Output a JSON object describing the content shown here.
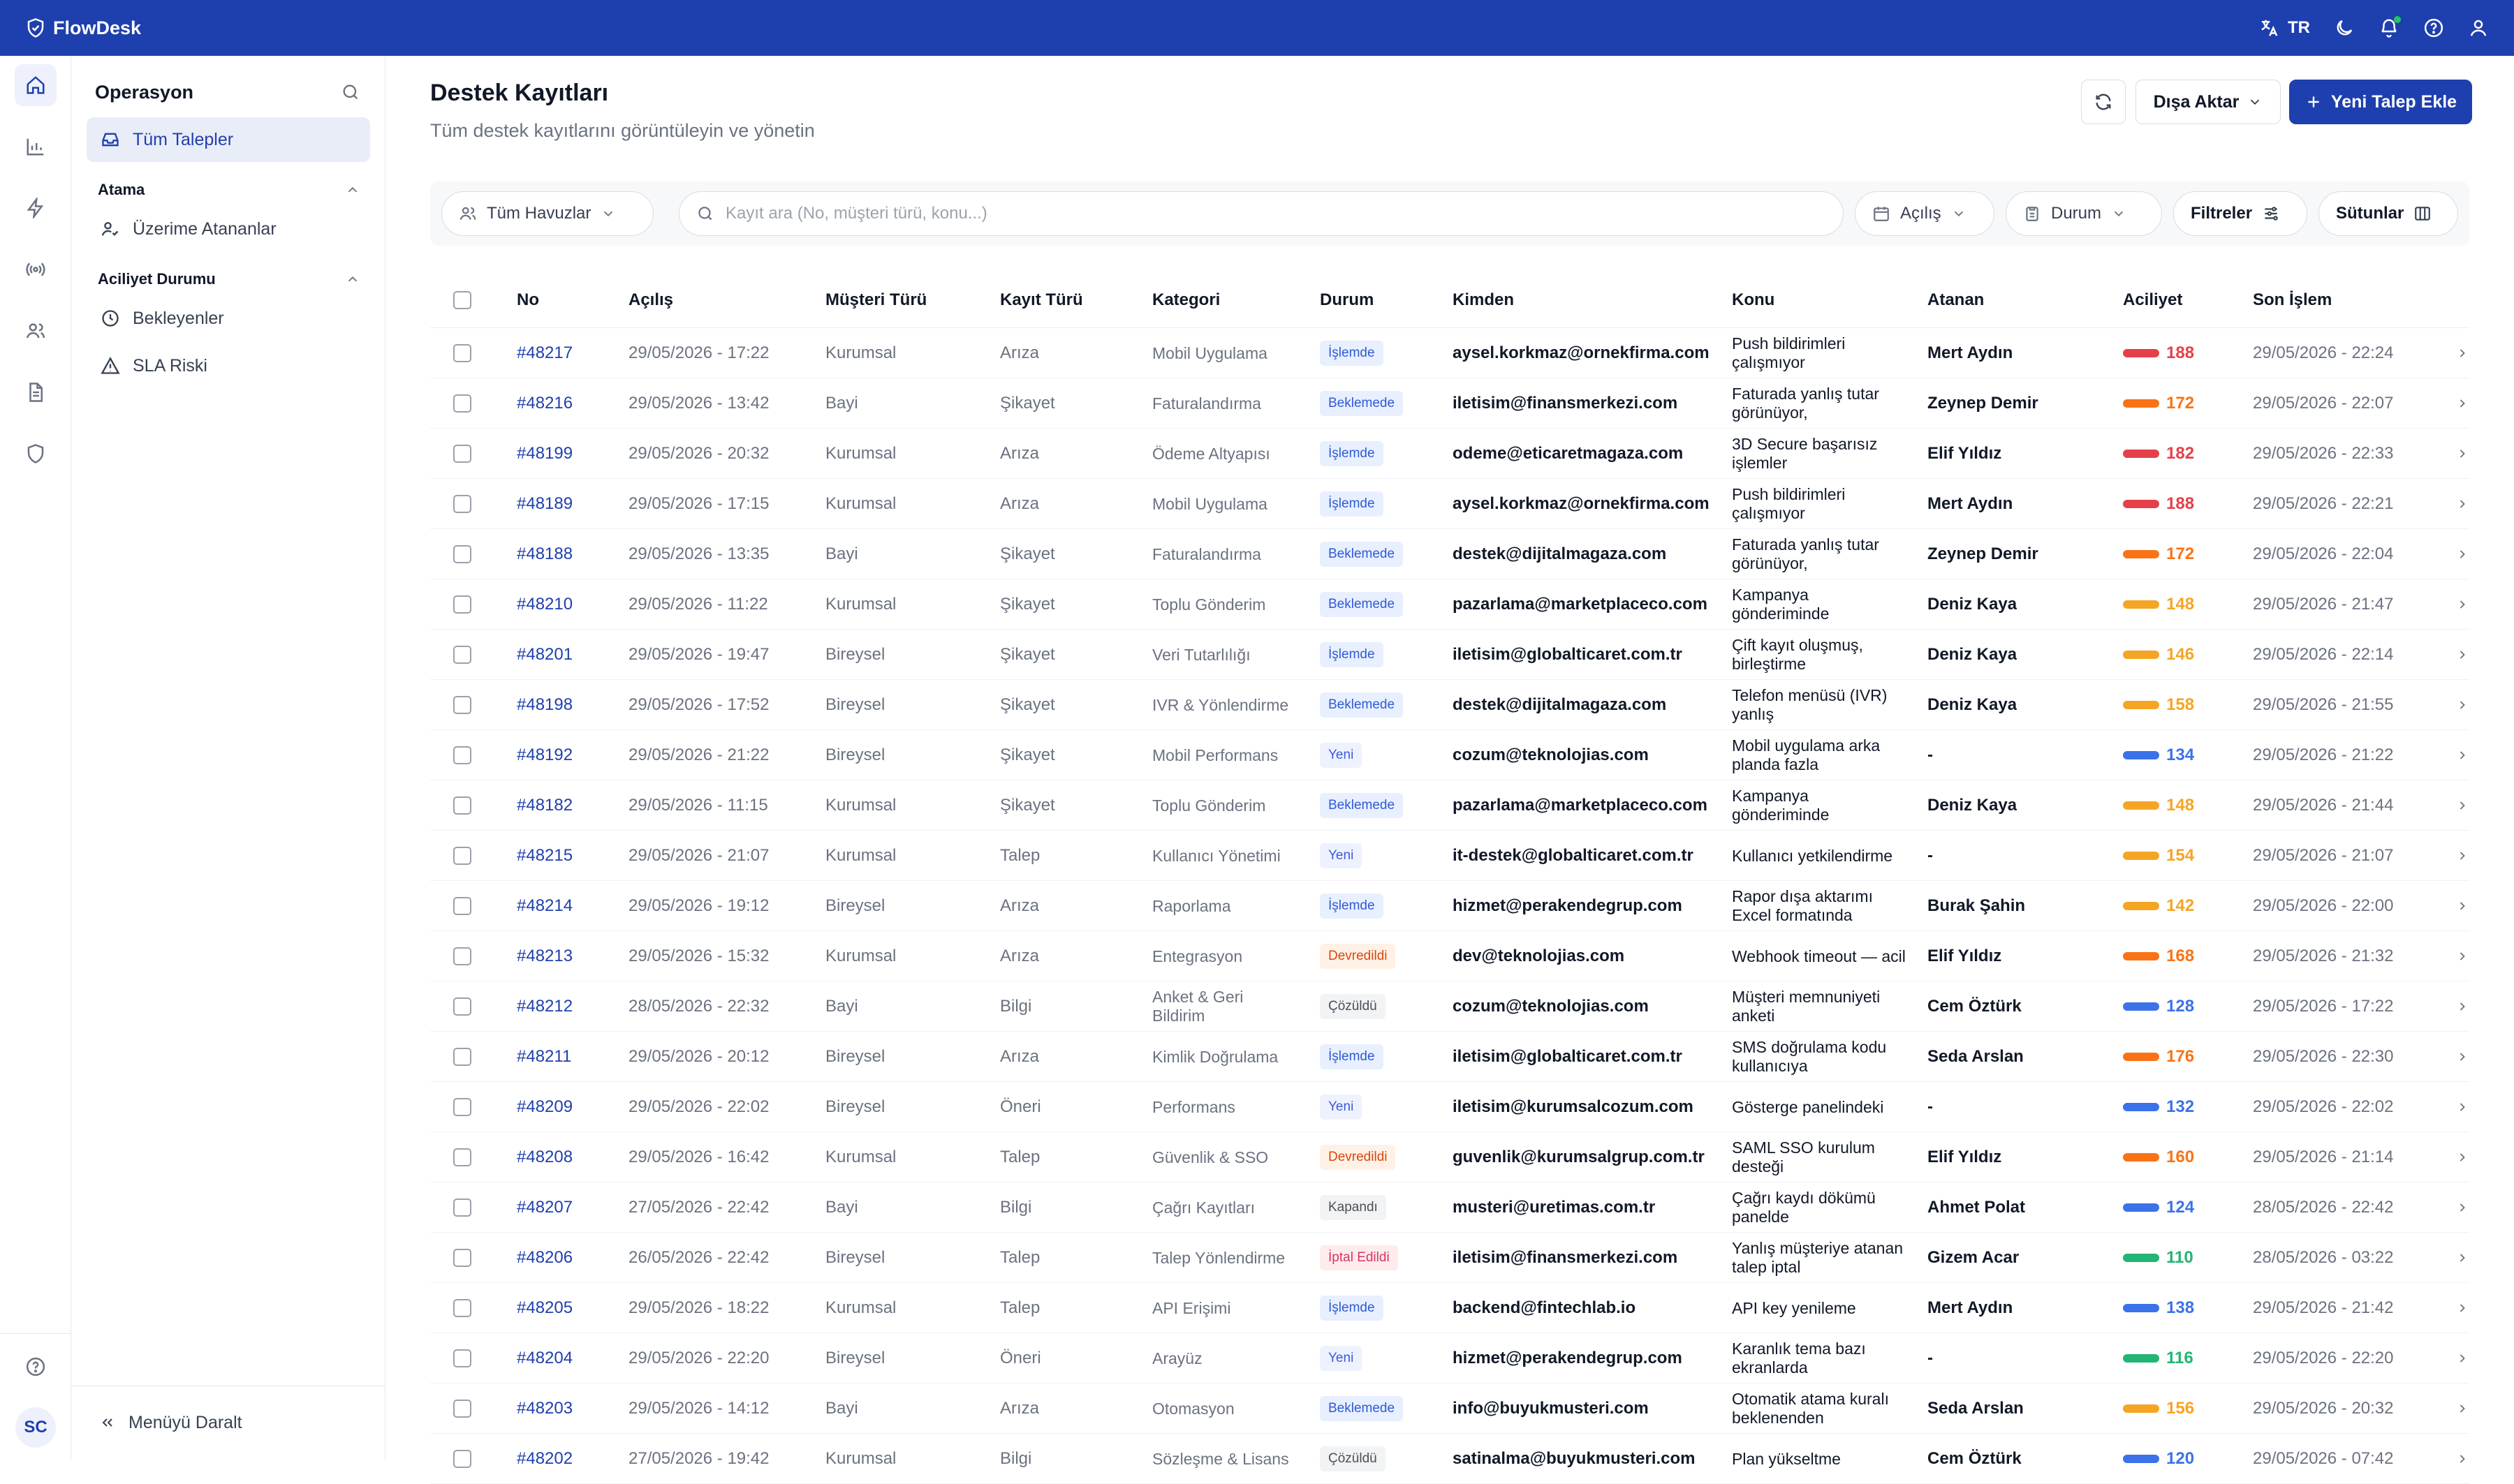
{
  "app": {
    "name": "FlowDesk",
    "lang": "TR"
  },
  "colors": {
    "brand": "#1e3fae",
    "red": "#e5404a",
    "orange": "#f97316",
    "amber": "#f5a524",
    "blue": "#3b72e8",
    "green": "#22b573"
  },
  "rail": {
    "icons": [
      "home-icon",
      "chart-icon",
      "bolt-icon",
      "broadcast-icon",
      "users-icon",
      "document-icon",
      "shield-icon"
    ],
    "avatar": "SC"
  },
  "sidebar": {
    "title": "Operasyon",
    "all": "Tüm Talepler",
    "sections": [
      {
        "title": "Atama",
        "items": [
          "Üzerime Atananlar"
        ]
      },
      {
        "title": "Aciliyet Durumu",
        "items": [
          "Bekleyenler",
          "SLA Riski"
        ]
      }
    ],
    "collapse": "Menüyü Daralt"
  },
  "page": {
    "title": "Destek Kayıtları",
    "subtitle": "Tüm destek kayıtlarını görüntüleyin ve yönetin",
    "export": "Dışa Aktar",
    "new": "Yeni Talep Ekle"
  },
  "filters": {
    "pool": "Tüm Havuzlar",
    "search_placeholder": "Kayıt ara (No, müşteri türü, konu...)",
    "opened": "Açılış",
    "status": "Durum",
    "filters": "Filtreler",
    "columns": "Sütunlar"
  },
  "columns": [
    "No",
    "Açılış",
    "Müşteri Türü",
    "Kayıt Türü",
    "Kategori",
    "Durum",
    "Kimden",
    "Konu",
    "Atanan",
    "Aciliyet",
    "Son İşlem"
  ],
  "rows": [
    {
      "no": "#48217",
      "open": "29/05/2026 - 17:22",
      "cust": "Kurumsal",
      "type": "Arıza",
      "cat": "Mobil Uygulama",
      "status": "İşlemde",
      "from": "aysel.korkmaz@ornekfirma.com",
      "subj": "Push bildirimleri çalışmıyor",
      "who": "Mert Aydın",
      "prio": "188",
      "pc": "red",
      "last": "29/05/2026 - 22:24"
    },
    {
      "no": "#48216",
      "open": "29/05/2026 - 13:42",
      "cust": "Bayi",
      "type": "Şikayet",
      "cat": "Faturalandırma",
      "status": "Beklemede",
      "from": "iletisim@finansmerkezi.com",
      "subj": "Faturada yanlış tutar görünüyor,",
      "who": "Zeynep Demir",
      "prio": "172",
      "pc": "orange",
      "last": "29/05/2026 - 22:07"
    },
    {
      "no": "#48199",
      "open": "29/05/2026 - 20:32",
      "cust": "Kurumsal",
      "type": "Arıza",
      "cat": "Ödeme Altyapısı",
      "status": "İşlemde",
      "from": "odeme@eticaretmagaza.com",
      "subj": "3D Secure başarısız işlemler",
      "who": "Elif Yıldız",
      "prio": "182",
      "pc": "red",
      "last": "29/05/2026 - 22:33"
    },
    {
      "no": "#48189",
      "open": "29/05/2026 - 17:15",
      "cust": "Kurumsal",
      "type": "Arıza",
      "cat": "Mobil Uygulama",
      "status": "İşlemde",
      "from": "aysel.korkmaz@ornekfirma.com",
      "subj": "Push bildirimleri çalışmıyor",
      "who": "Mert Aydın",
      "prio": "188",
      "pc": "red",
      "last": "29/05/2026 - 22:21"
    },
    {
      "no": "#48188",
      "open": "29/05/2026 - 13:35",
      "cust": "Bayi",
      "type": "Şikayet",
      "cat": "Faturalandırma",
      "status": "Beklemede",
      "from": "destek@dijitalmagaza.com",
      "subj": "Faturada yanlış tutar görünüyor,",
      "who": "Zeynep Demir",
      "prio": "172",
      "pc": "orange",
      "last": "29/05/2026 - 22:04"
    },
    {
      "no": "#48210",
      "open": "29/05/2026 - 11:22",
      "cust": "Kurumsal",
      "type": "Şikayet",
      "cat": "Toplu Gönderim",
      "status": "Beklemede",
      "from": "pazarlama@marketplaceco.com",
      "subj": "Kampanya gönderiminde",
      "who": "Deniz Kaya",
      "prio": "148",
      "pc": "amber",
      "last": "29/05/2026 - 21:47"
    },
    {
      "no": "#48201",
      "open": "29/05/2026 - 19:47",
      "cust": "Bireysel",
      "type": "Şikayet",
      "cat": "Veri Tutarlılığı",
      "status": "İşlemde",
      "from": "iletisim@globalticaret.com.tr",
      "subj": "Çift kayıt oluşmuş, birleştirme",
      "who": "Deniz Kaya",
      "prio": "146",
      "pc": "amber",
      "last": "29/05/2026 - 22:14"
    },
    {
      "no": "#48198",
      "open": "29/05/2026 - 17:52",
      "cust": "Bireysel",
      "type": "Şikayet",
      "cat": "IVR & Yönlendirme",
      "status": "Beklemede",
      "from": "destek@dijitalmagaza.com",
      "subj": "Telefon menüsü (IVR) yanlış",
      "who": "Deniz Kaya",
      "prio": "158",
      "pc": "amber",
      "last": "29/05/2026 - 21:55"
    },
    {
      "no": "#48192",
      "open": "29/05/2026 - 21:22",
      "cust": "Bireysel",
      "type": "Şikayet",
      "cat": "Mobil Performans",
      "status": "Yeni",
      "from": "cozum@teknolojias.com",
      "subj": "Mobil uygulama arka planda fazla",
      "who": "-",
      "prio": "134",
      "pc": "blue",
      "last": "29/05/2026 - 21:22"
    },
    {
      "no": "#48182",
      "open": "29/05/2026 - 11:15",
      "cust": "Kurumsal",
      "type": "Şikayet",
      "cat": "Toplu Gönderim",
      "status": "Beklemede",
      "from": "pazarlama@marketplaceco.com",
      "subj": "Kampanya gönderiminde",
      "who": "Deniz Kaya",
      "prio": "148",
      "pc": "amber",
      "last": "29/05/2026 - 21:44"
    },
    {
      "no": "#48215",
      "open": "29/05/2026 - 21:07",
      "cust": "Kurumsal",
      "type": "Talep",
      "cat": "Kullanıcı Yönetimi",
      "status": "Yeni",
      "from": "it-destek@globalticaret.com.tr",
      "subj": "Kullanıcı yetkilendirme",
      "who": "-",
      "prio": "154",
      "pc": "amber",
      "last": "29/05/2026 - 21:07"
    },
    {
      "no": "#48214",
      "open": "29/05/2026 - 19:12",
      "cust": "Bireysel",
      "type": "Arıza",
      "cat": "Raporlama",
      "status": "İşlemde",
      "from": "hizmet@perakendegrup.com",
      "subj": "Rapor dışa aktarımı Excel formatında",
      "who": "Burak Şahin",
      "prio": "142",
      "pc": "amber",
      "last": "29/05/2026 - 22:00"
    },
    {
      "no": "#48213",
      "open": "29/05/2026 - 15:32",
      "cust": "Kurumsal",
      "type": "Arıza",
      "cat": "Entegrasyon",
      "status": "Devredildi",
      "from": "dev@teknolojias.com",
      "subj": "Webhook timeout — acil",
      "who": "Elif Yıldız",
      "prio": "168",
      "pc": "orange",
      "last": "29/05/2026 - 21:32"
    },
    {
      "no": "#48212",
      "open": "28/05/2026 - 22:32",
      "cust": "Bayi",
      "type": "Bilgi",
      "cat": "Anket & Geri Bildirim",
      "status": "Çözüldü",
      "from": "cozum@teknolojias.com",
      "subj": "Müşteri memnuniyeti anketi",
      "who": "Cem Öztürk",
      "prio": "128",
      "pc": "blue",
      "last": "29/05/2026 - 17:22"
    },
    {
      "no": "#48211",
      "open": "29/05/2026 - 20:12",
      "cust": "Bireysel",
      "type": "Arıza",
      "cat": "Kimlik Doğrulama",
      "status": "İşlemde",
      "from": "iletisim@globalticaret.com.tr",
      "subj": "SMS doğrulama kodu kullanıcıya",
      "who": "Seda Arslan",
      "prio": "176",
      "pc": "orange",
      "last": "29/05/2026 - 22:30"
    },
    {
      "no": "#48209",
      "open": "29/05/2026 - 22:02",
      "cust": "Bireysel",
      "type": "Öneri",
      "cat": "Performans",
      "status": "Yeni",
      "from": "iletisim@kurumsalcozum.com",
      "subj": "Gösterge panelindeki",
      "who": "-",
      "prio": "132",
      "pc": "blue",
      "last": "29/05/2026 - 22:02"
    },
    {
      "no": "#48208",
      "open": "29/05/2026 - 16:42",
      "cust": "Kurumsal",
      "type": "Talep",
      "cat": "Güvenlik & SSO",
      "status": "Devredildi",
      "from": "guvenlik@kurumsalgrup.com.tr",
      "subj": "SAML SSO kurulum desteği",
      "who": "Elif Yıldız",
      "prio": "160",
      "pc": "orange",
      "last": "29/05/2026 - 21:14"
    },
    {
      "no": "#48207",
      "open": "27/05/2026 - 22:42",
      "cust": "Bayi",
      "type": "Bilgi",
      "cat": "Çağrı Kayıtları",
      "status": "Kapandı",
      "from": "musteri@uretimas.com.tr",
      "subj": "Çağrı kaydı dökümü panelde",
      "who": "Ahmet Polat",
      "prio": "124",
      "pc": "blue",
      "last": "28/05/2026 - 22:42"
    },
    {
      "no": "#48206",
      "open": "26/05/2026 - 22:42",
      "cust": "Bireysel",
      "type": "Talep",
      "cat": "Talep Yönlendirme",
      "status": "İptal Edildi",
      "from": "iletisim@finansmerkezi.com",
      "subj": "Yanlış müşteriye atanan talep iptal",
      "who": "Gizem Acar",
      "prio": "110",
      "pc": "green",
      "last": "28/05/2026 - 03:22"
    },
    {
      "no": "#48205",
      "open": "29/05/2026 - 18:22",
      "cust": "Kurumsal",
      "type": "Talep",
      "cat": "API Erişimi",
      "status": "İşlemde",
      "from": "backend@fintechlab.io",
      "subj": "API key yenileme",
      "who": "Mert Aydın",
      "prio": "138",
      "pc": "blue",
      "last": "29/05/2026 - 21:42"
    },
    {
      "no": "#48204",
      "open": "29/05/2026 - 22:20",
      "cust": "Bireysel",
      "type": "Öneri",
      "cat": "Arayüz",
      "status": "Yeni",
      "from": "hizmet@perakendegrup.com",
      "subj": "Karanlık tema bazı ekranlarda",
      "who": "-",
      "prio": "116",
      "pc": "green",
      "last": "29/05/2026 - 22:20"
    },
    {
      "no": "#48203",
      "open": "29/05/2026 - 14:12",
      "cust": "Bayi",
      "type": "Arıza",
      "cat": "Otomasyon",
      "status": "Beklemede",
      "from": "info@buyukmusteri.com",
      "subj": "Otomatik atama kuralı beklenenden",
      "who": "Seda Arslan",
      "prio": "156",
      "pc": "amber",
      "last": "29/05/2026 - 20:32"
    },
    {
      "no": "#48202",
      "open": "27/05/2026 - 19:42",
      "cust": "Kurumsal",
      "type": "Bilgi",
      "cat": "Sözleşme & Lisans",
      "status": "Çözüldü",
      "from": "satinalma@buyukmusteri.com",
      "subj": "Plan yükseltme",
      "who": "Cem Öztürk",
      "prio": "120",
      "pc": "blue",
      "last": "29/05/2026 - 07:42"
    }
  ],
  "status_styles": {
    "İşlemde": {
      "bg": "#e8efff",
      "fg": "#2f5bd3"
    },
    "Beklemede": {
      "bg": "#e8efff",
      "fg": "#2f5bd3"
    },
    "Yeni": {
      "bg": "#eef2ff",
      "fg": "#3b5bdb"
    },
    "Devredildi": {
      "bg": "#fff1e6",
      "fg": "#d9480f"
    },
    "Çözüldü": {
      "bg": "#f1f3f5",
      "fg": "#495057"
    },
    "Kapandı": {
      "bg": "#f1f3f5",
      "fg": "#495057"
    },
    "İptal Edildi": {
      "bg": "#fdecea",
      "fg": "#d6336c"
    }
  }
}
